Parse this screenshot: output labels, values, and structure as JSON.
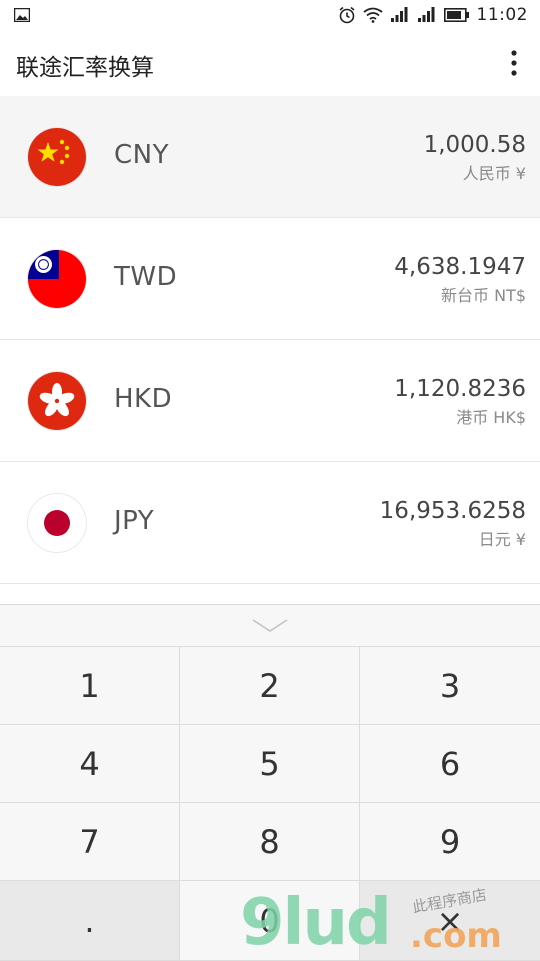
{
  "status_bar": {
    "time": "11:02",
    "icons": [
      "image-icon",
      "alarm-icon",
      "wifi-icon",
      "signal-icon",
      "battery-icon"
    ]
  },
  "app_bar": {
    "title": "联途汇率换算",
    "menu_icon": "more-vert-icon"
  },
  "currencies": [
    {
      "code": "CNY",
      "amount": "1,000.58",
      "name": "人民币 ¥",
      "flag": "china-flag-icon",
      "selected": true
    },
    {
      "code": "TWD",
      "amount": "4,638.1947",
      "name": "新台币 NT$",
      "flag": "taiwan-flag-icon",
      "selected": false
    },
    {
      "code": "HKD",
      "amount": "1,120.8236",
      "name": "港币 HK$",
      "flag": "hongkong-flag-icon",
      "selected": false
    },
    {
      "code": "JPY",
      "amount": "16,953.6258",
      "name": "日元 ¥",
      "flag": "japan-flag-icon",
      "selected": false
    }
  ],
  "keypad": {
    "collapse_icon": "chevron-down-icon",
    "keys": [
      "1",
      "2",
      "3",
      "4",
      "5",
      "6",
      "7",
      "8",
      "9",
      ".",
      "0",
      "×"
    ]
  },
  "watermark": {
    "main": "9lud",
    "suffix": ".com",
    "small": "此程序商店"
  },
  "colors": {
    "china_red": "#de2910",
    "star_yellow": "#ffde00",
    "taiwan_blue": "#000095",
    "hk_red": "#de2910",
    "japan_red": "#bc002d"
  }
}
